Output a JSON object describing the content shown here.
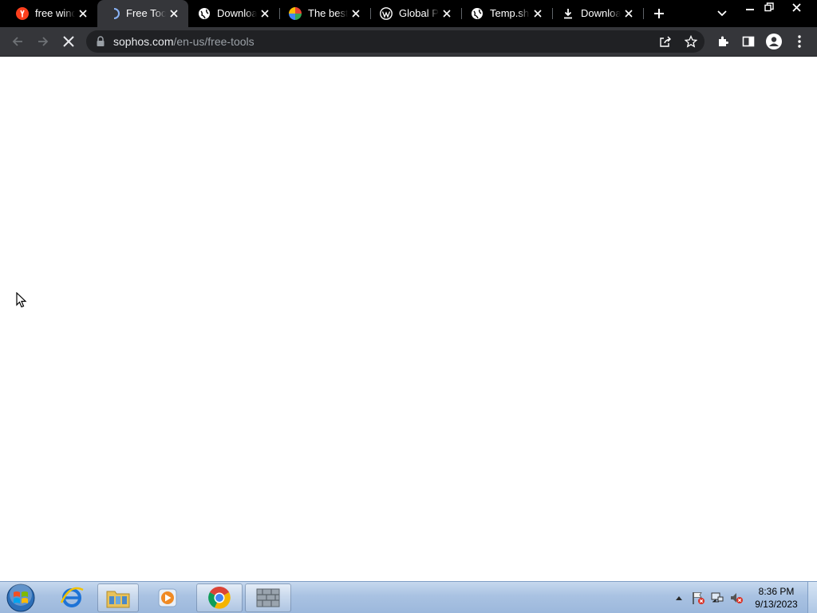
{
  "browser": {
    "tabs": [
      {
        "title": "free windows malware removal",
        "icon": "yandex-icon",
        "active": false
      },
      {
        "title": "Free Tools",
        "icon": "loading-spinner-icon",
        "active": true
      },
      {
        "title": "Download",
        "icon": "globe-icon",
        "active": false
      },
      {
        "title": "The best",
        "icon": "colorwheel-icon",
        "active": false
      },
      {
        "title": "Global PC",
        "icon": "wordpress-icon",
        "active": false
      },
      {
        "title": "Temp.sh",
        "icon": "globe-icon",
        "active": false
      },
      {
        "title": "Download",
        "icon": "download-icon",
        "active": false
      }
    ],
    "address": {
      "host": "sophos.com",
      "path": "/en-us/free-tools"
    }
  },
  "taskbar": {
    "apps": [
      "start-orb",
      "internet-explorer",
      "windows-explorer",
      "media-player",
      "google-chrome",
      "unknown-app"
    ],
    "clock": {
      "time": "8:36 PM",
      "date": "9/13/2023"
    }
  },
  "colors": {
    "tabstrip": "#000000",
    "toolbar": "#35363a",
    "omnibox": "#202124",
    "page": "#ffffff"
  }
}
